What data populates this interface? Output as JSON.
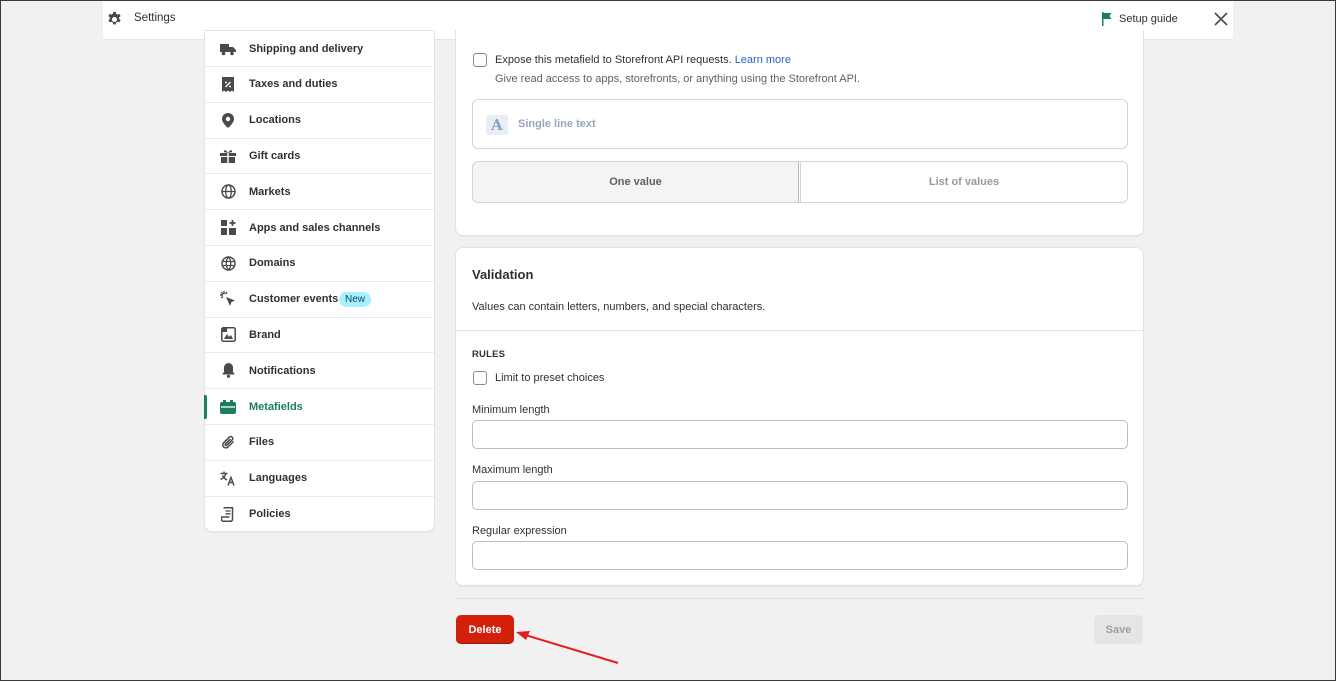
{
  "topbar": {
    "title": "Settings",
    "setup_guide": "Setup guide"
  },
  "sidebar": {
    "items": [
      {
        "label": "Shipping and delivery",
        "icon": "truck-icon"
      },
      {
        "label": "Taxes and duties",
        "icon": "tax-receipt-icon"
      },
      {
        "label": "Locations",
        "icon": "location-pin-icon"
      },
      {
        "label": "Gift cards",
        "icon": "gift-icon"
      },
      {
        "label": "Markets",
        "icon": "globe-icon"
      },
      {
        "label": "Apps and sales channels",
        "icon": "apps-grid-icon"
      },
      {
        "label": "Domains",
        "icon": "world-icon"
      },
      {
        "label": "Customer events",
        "icon": "cursor-click-icon",
        "badge": "New"
      },
      {
        "label": "Brand",
        "icon": "brand-icon"
      },
      {
        "label": "Notifications",
        "icon": "bell-icon"
      },
      {
        "label": "Metafields",
        "icon": "metafields-icon",
        "active": true
      },
      {
        "label": "Files",
        "icon": "paperclip-icon"
      },
      {
        "label": "Languages",
        "icon": "translate-icon"
      },
      {
        "label": "Policies",
        "icon": "document-icon"
      }
    ]
  },
  "storefront": {
    "checkbox_label": "Expose this metafield to Storefront API requests.",
    "learn_more": "Learn more",
    "help_text": "Give read access to apps, storefronts, or anything using the Storefront API.",
    "type_label": "Single line text",
    "type_icon_letter": "A",
    "options": [
      "One value",
      "List of values"
    ]
  },
  "validation": {
    "title": "Validation",
    "description": "Values can contain letters, numbers, and special characters.",
    "rules_heading": "RULES",
    "preset_label": "Limit to preset choices",
    "min_label": "Minimum length",
    "max_label": "Maximum length",
    "regex_label": "Regular expression"
  },
  "footer": {
    "delete_label": "Delete",
    "save_label": "Save"
  },
  "colors": {
    "accent_green": "#1a7f5a",
    "delete_red": "#d2200b",
    "annotation_arrow": "#e02020"
  }
}
